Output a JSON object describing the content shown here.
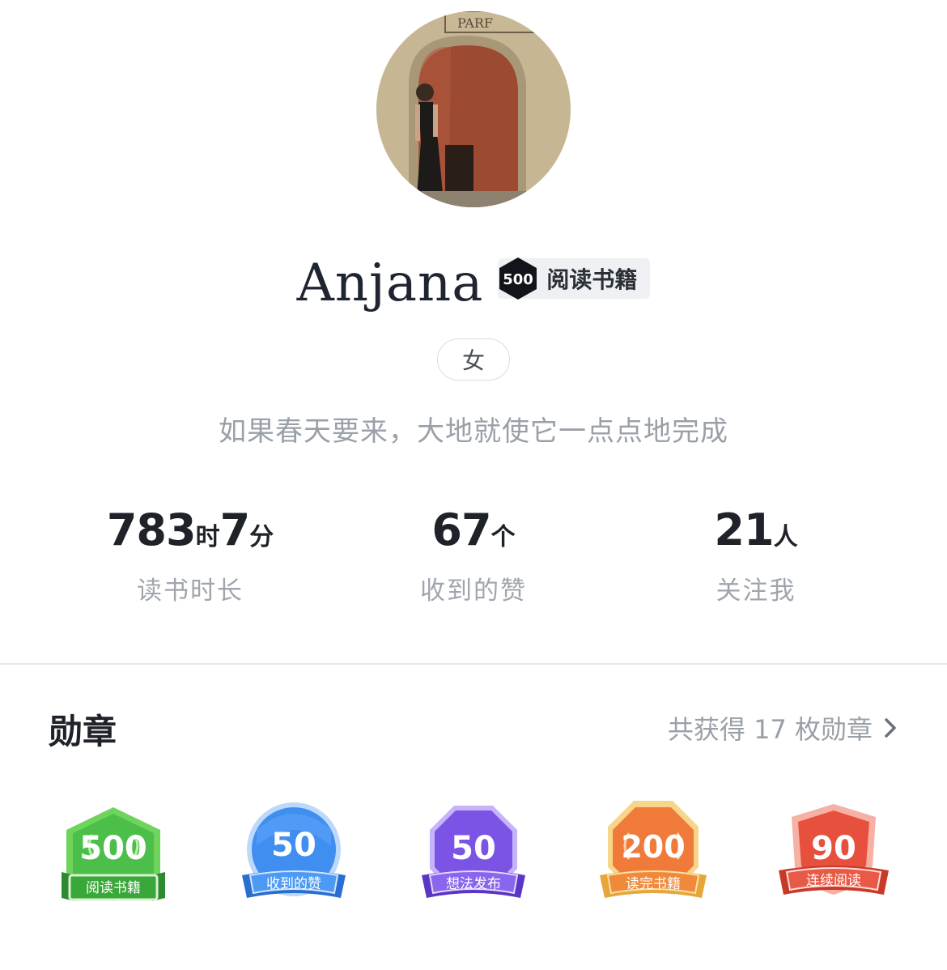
{
  "profile": {
    "name": "Anjana",
    "title_badge": {
      "number": "500",
      "label": "阅读书籍"
    },
    "gender": "女",
    "signature": "如果春天要来，大地就使它一点点地完成"
  },
  "stats": [
    {
      "value_a": "783",
      "unit_a": "时",
      "value_b": "7",
      "unit_b": "分",
      "label": "读书时长"
    },
    {
      "value_a": "67",
      "unit_a": "个",
      "value_b": "",
      "unit_b": "",
      "label": "收到的赞"
    },
    {
      "value_a": "21",
      "unit_a": "人",
      "value_b": "",
      "unit_b": "",
      "label": "关注我"
    }
  ],
  "medals_section": {
    "title": "勋章",
    "summary": "共获得 17 枚勋章",
    "icon": "chevron-right-icon"
  },
  "medals": [
    {
      "number": "500",
      "label": "阅读书籍",
      "color": "#4cbf4a",
      "shape": "hexagon"
    },
    {
      "number": "50",
      "label": "收到的赞",
      "color": "#3f8ef0",
      "shape": "circle"
    },
    {
      "number": "50",
      "label": "想法发布",
      "color": "#7b54e6",
      "shape": "octagon"
    },
    {
      "number": "200",
      "label": "读完书籍",
      "color": "#f07a3a",
      "shape": "octagon"
    },
    {
      "number": "90",
      "label": "连续阅读",
      "color": "#e8503e",
      "shape": "shield"
    }
  ]
}
